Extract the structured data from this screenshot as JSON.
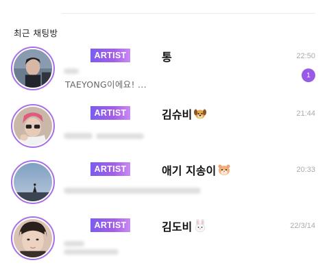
{
  "section_title": "최근 채팅방",
  "colors": {
    "accent": "#9a5ae8",
    "ring": "#a76ee8",
    "badge_gradient_start": "#7a5cf0",
    "badge_gradient_end": "#c88af5"
  },
  "chats": [
    {
      "badge": "ARTIST",
      "name": "통",
      "emoji": "",
      "time": "22:50",
      "preview": "TAEYONG이에요! ...",
      "unread": "1"
    },
    {
      "badge": "ARTIST",
      "name": "김슈비",
      "emoji": "dog-face-icon",
      "time": "21:44",
      "preview": "",
      "unread": ""
    },
    {
      "badge": "ARTIST",
      "name": "애기 지송이",
      "emoji": "hamster-face-icon",
      "time": "20:33",
      "preview": "",
      "unread": ""
    },
    {
      "badge": "ARTIST",
      "name": "김도비",
      "emoji": "rabbit-face-icon",
      "time": "22/3/14",
      "preview": "",
      "unread": ""
    }
  ]
}
